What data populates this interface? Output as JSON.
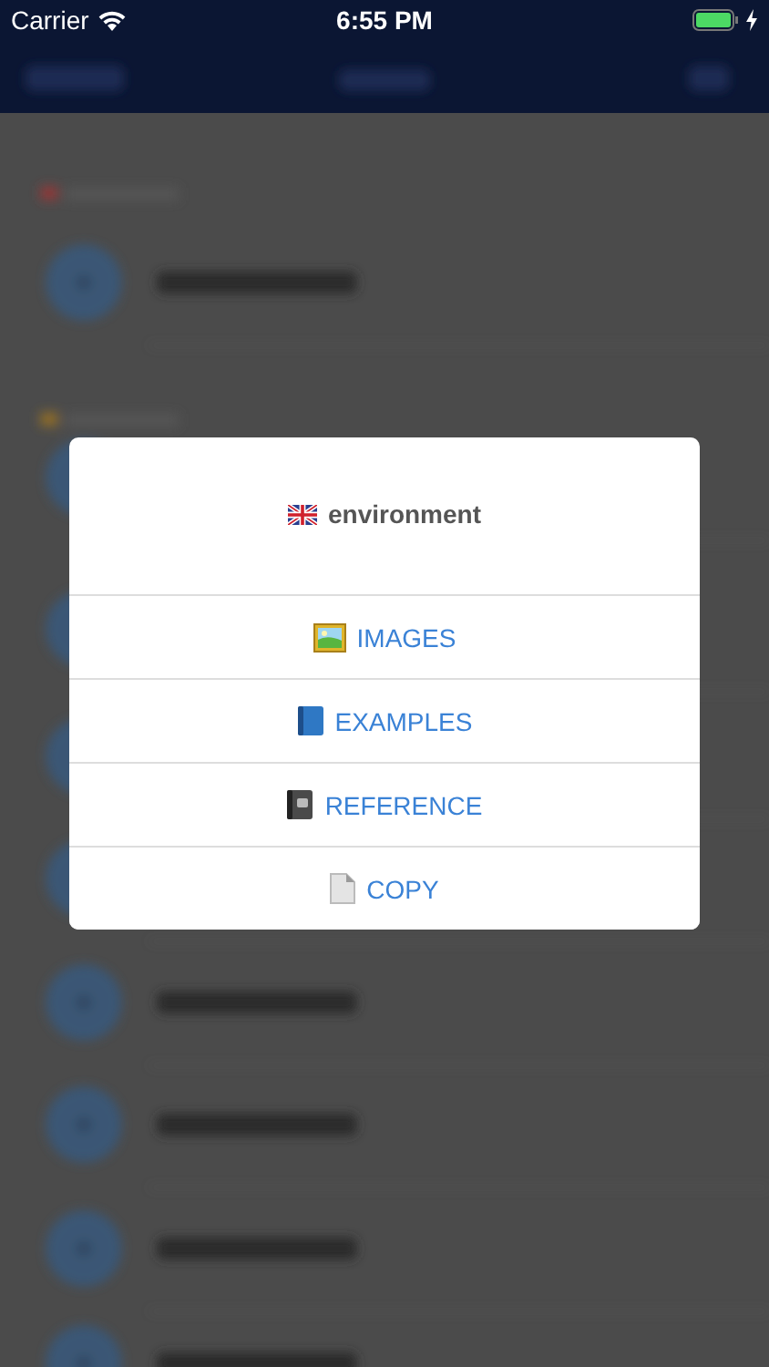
{
  "status_bar": {
    "carrier": "Carrier",
    "time": "6:55 PM"
  },
  "dialog": {
    "title": "environment",
    "actions": [
      {
        "label": "IMAGES"
      },
      {
        "label": "EXAMPLES"
      },
      {
        "label": "REFERENCE"
      },
      {
        "label": "COPY"
      }
    ]
  }
}
